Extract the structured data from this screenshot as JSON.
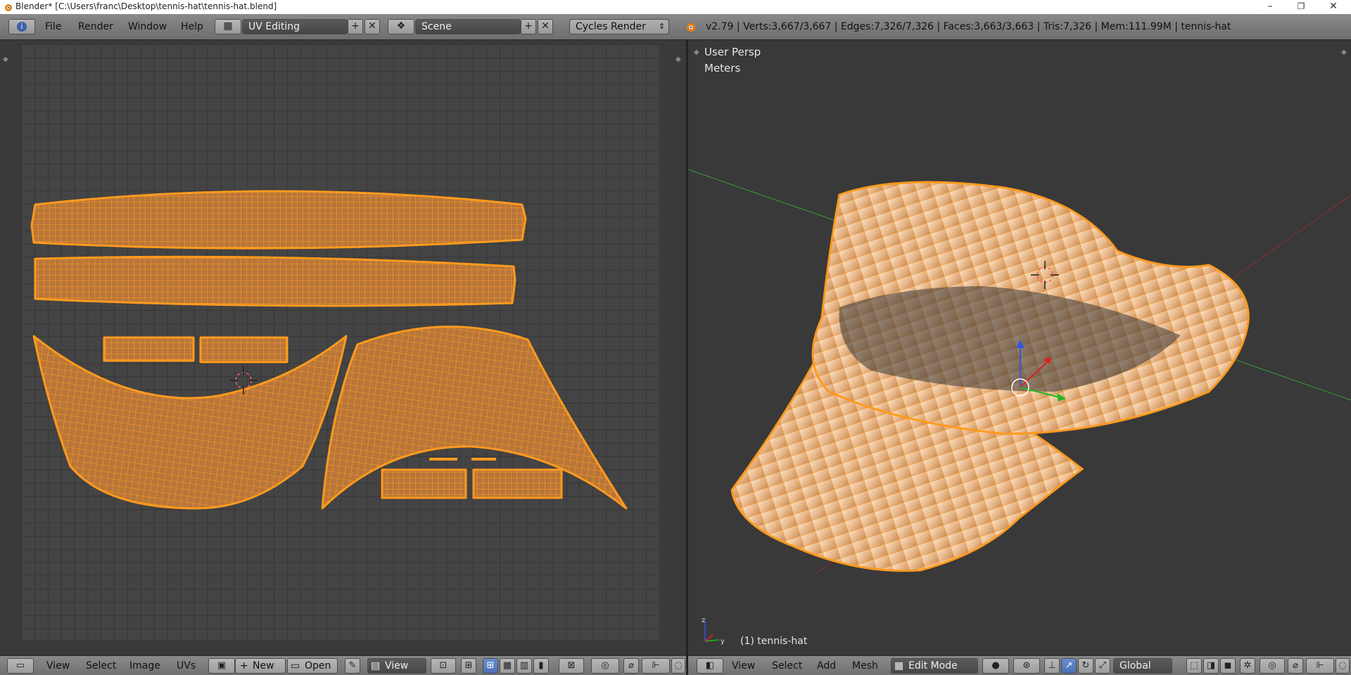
{
  "window": {
    "title": "Blender* [C:\\Users\\franc\\Desktop\\tennis-hat\\tennis-hat.blend]",
    "minimize": "–",
    "restore": "❐",
    "close": "✕"
  },
  "info_header": {
    "menus": [
      "File",
      "Render",
      "Window",
      "Help"
    ],
    "screen_layout": "UV Editing",
    "scene": "Scene",
    "render_engine": "Cycles Render",
    "stats": "v2.79 | Verts:3,667/3,667 | Edges:7,326/7,326 | Faces:3,663/3,663 | Tris:7,326 | Mem:111.99M | tennis-hat"
  },
  "viewport": {
    "view_name": "User Persp",
    "units": "Meters",
    "object_label": "(1) tennis-hat",
    "colors": {
      "mesh_fill": "#f2c79a",
      "wire": "#ff9a1e",
      "background": "#393939",
      "x_axis": "#c0392b",
      "y_axis": "#3a9a3a"
    }
  },
  "uv_header": {
    "menus": [
      "View",
      "Select",
      "Image",
      "UVs"
    ],
    "new_label": "New",
    "open_label": "Open",
    "view_label": "View"
  },
  "view3d_header": {
    "menus": [
      "View",
      "Select",
      "Add",
      "Mesh"
    ],
    "mode": "Edit Mode",
    "orientation": "Global"
  }
}
